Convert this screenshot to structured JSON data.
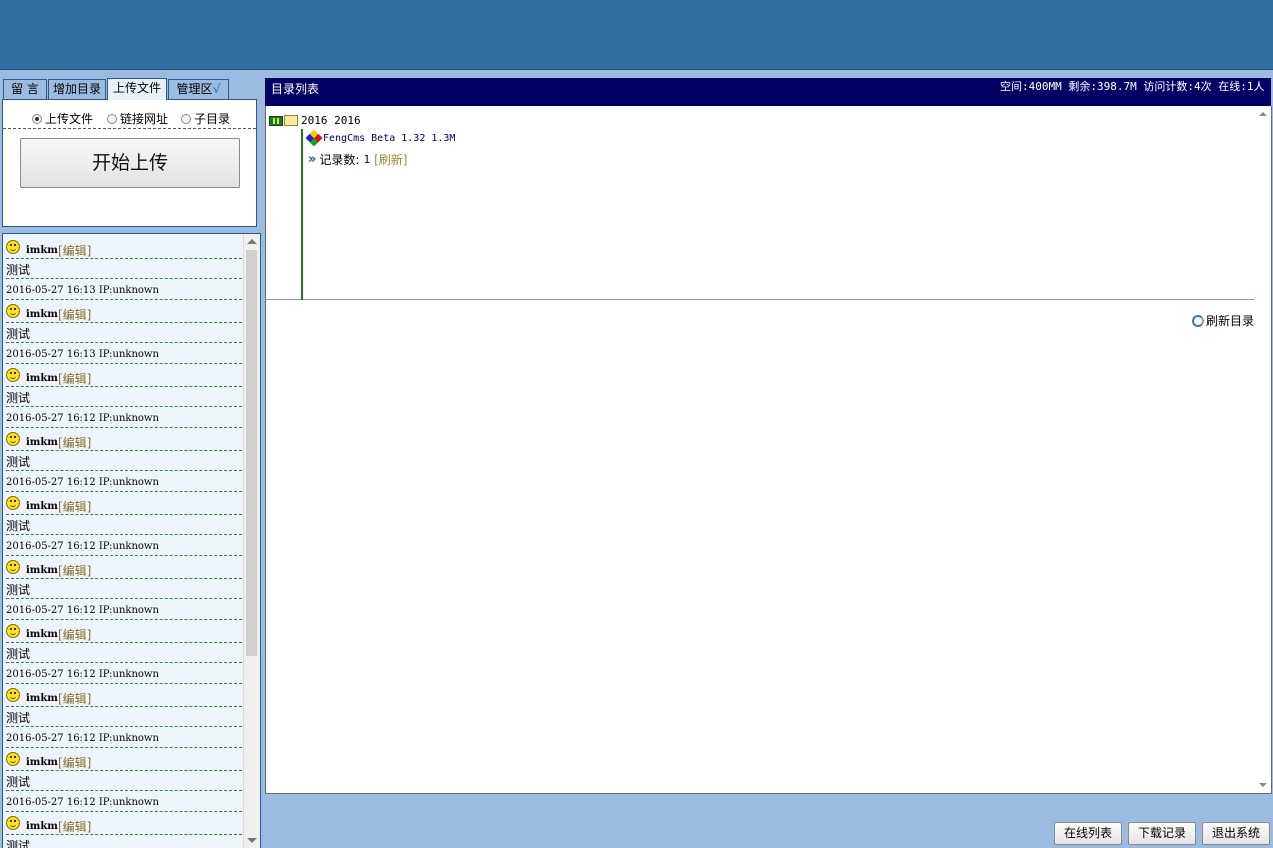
{
  "tabs": [
    {
      "label": "留 言",
      "active": false
    },
    {
      "label": "增加目录",
      "active": false
    },
    {
      "label": "上传文件",
      "active": true
    },
    {
      "label": "管理区",
      "active": false,
      "icon": "check-icon",
      "icon_glyph": "√"
    }
  ],
  "upload": {
    "options": [
      {
        "label": "上传文件",
        "checked": true
      },
      {
        "label": "链接网址",
        "checked": false
      },
      {
        "label": "子目录",
        "checked": false
      }
    ],
    "start_label": "开始上传"
  },
  "messages": [
    {
      "user": "imkm",
      "edit": "[编辑]",
      "text": "测试",
      "meta": "2016-05-27 16:13 IP:unknown"
    },
    {
      "user": "imkm",
      "edit": "[编辑]",
      "text": "测试",
      "meta": "2016-05-27 16:13 IP:unknown"
    },
    {
      "user": "imkm",
      "edit": "[编辑]",
      "text": "测试",
      "meta": "2016-05-27 16:12 IP:unknown"
    },
    {
      "user": "imkm",
      "edit": "[编辑]",
      "text": "测试",
      "meta": "2016-05-27 16:12 IP:unknown"
    },
    {
      "user": "imkm",
      "edit": "[编辑]",
      "text": "测试",
      "meta": "2016-05-27 16:12 IP:unknown"
    },
    {
      "user": "imkm",
      "edit": "[编辑]",
      "text": "测试",
      "meta": "2016-05-27 16:12 IP:unknown"
    },
    {
      "user": "imkm",
      "edit": "[编辑]",
      "text": "测试",
      "meta": "2016-05-27 16:12 IP:unknown"
    },
    {
      "user": "imkm",
      "edit": "[编辑]",
      "text": "测试",
      "meta": "2016-05-27 16:12 IP:unknown"
    },
    {
      "user": "imkm",
      "edit": "[编辑]",
      "text": "测试",
      "meta": "2016-05-27 16:12 IP:unknown"
    },
    {
      "user": "imkm",
      "edit": "[编辑]",
      "text": "测试",
      "meta": ""
    }
  ],
  "directory": {
    "title": "目录列表",
    "stats": "空间:400MM 剩余:398.7M 访问计数:4次 在线:1人",
    "root_label": "2016 2016",
    "file_label": "FengCms Beta 1.32 1.3M",
    "count_label": "记录数:",
    "count_value": "1",
    "refresh_label": "[刷新]",
    "refresh_dir_label": "刷新目录"
  },
  "actions": [
    {
      "label": "在线列表"
    },
    {
      "label": "下载记录"
    },
    {
      "label": "退出系统"
    }
  ],
  "colors": {
    "topbar": "#2f6fa4",
    "background": "#9cbbe0",
    "header": "#020264",
    "tree_line": "#1f7a1f"
  }
}
